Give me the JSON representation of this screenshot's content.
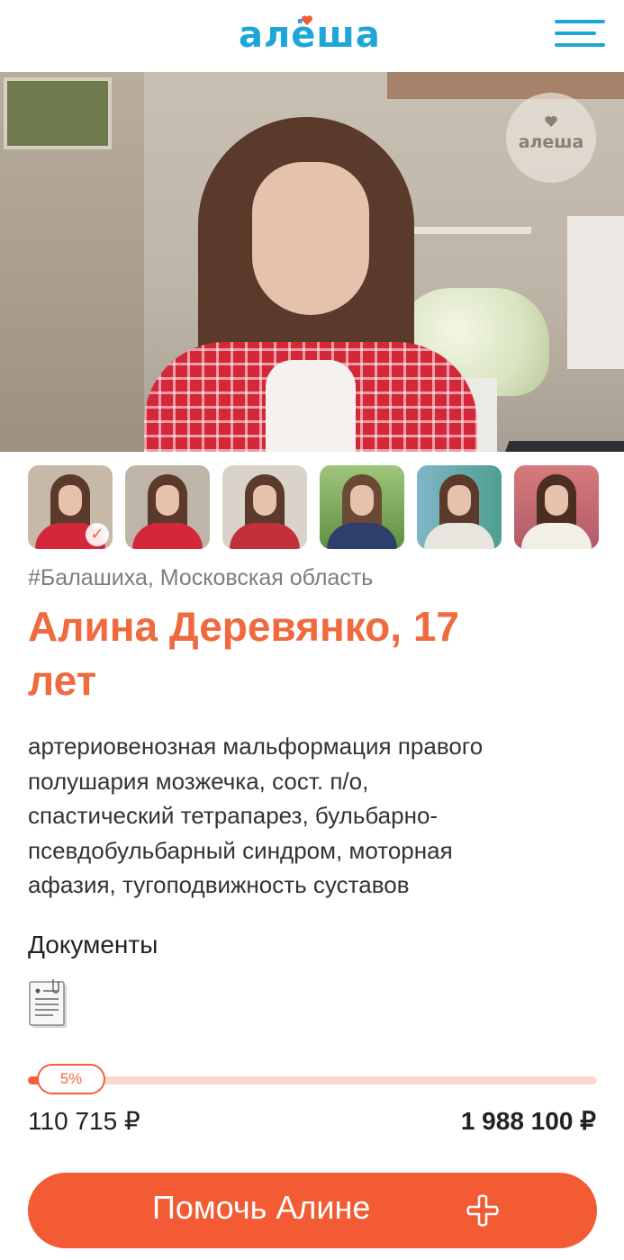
{
  "header": {
    "logo_text": "алёша",
    "menu_icon": "hamburger-icon"
  },
  "hero": {
    "watermark_text": "алеша"
  },
  "gallery": {
    "thumbnails": [
      {
        "selected": true
      },
      {
        "selected": false
      },
      {
        "selected": false
      },
      {
        "selected": false
      },
      {
        "selected": false
      },
      {
        "selected": false
      }
    ],
    "check_icon": "✓"
  },
  "profile": {
    "location": "#Балашиха, Московская область",
    "name_line1": "Алина Деревянко, 17",
    "name_line2": "лет",
    "diagnosis_lines": [
      "артериовенозная мальформация правого",
      "полушария мозжечка, сост. п/о,",
      "спастический тетрапарез, бульбарно-",
      "псевдобульбарный синдром, моторная",
      "афазия, тугоподвижность суставов"
    ]
  },
  "documents": {
    "title": "Документы",
    "icon": "document-icon"
  },
  "fundraising": {
    "percent": 5,
    "percent_label": "5%",
    "collected": "110 715 ₽",
    "goal": "1 988 100 ₽"
  },
  "cta": {
    "label": "Помочь Алине",
    "icon": "plus-icon"
  },
  "colors": {
    "brand_blue": "#1fa6d8",
    "accent_orange": "#f35b34",
    "heading_orange": "#ef6a3e",
    "progress_track": "#fbd8cd"
  }
}
